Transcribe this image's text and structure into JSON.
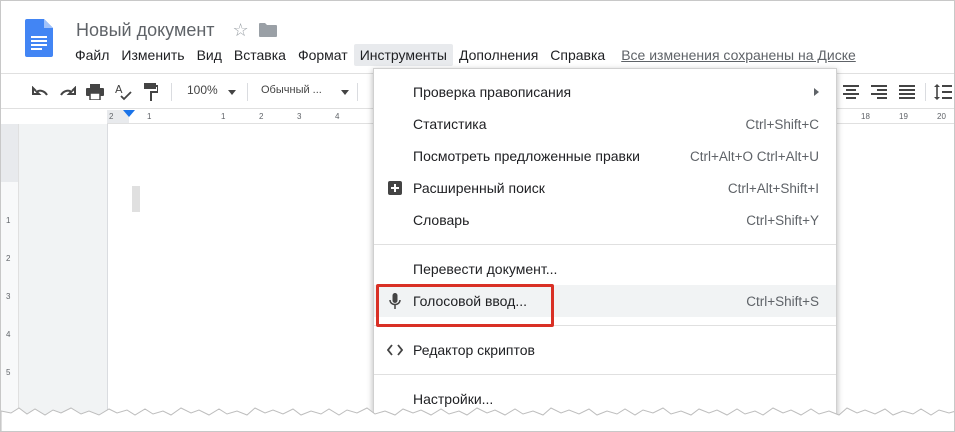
{
  "document": {
    "title": "Новый документ"
  },
  "menu": {
    "items": [
      {
        "label": "Файл"
      },
      {
        "label": "Изменить"
      },
      {
        "label": "Вид"
      },
      {
        "label": "Вставка"
      },
      {
        "label": "Формат"
      },
      {
        "label": "Инструменты"
      },
      {
        "label": "Дополнения"
      },
      {
        "label": "Справка"
      }
    ],
    "save_status": "Все изменения сохранены на Диске"
  },
  "toolbar": {
    "zoom": "100%",
    "style": "Обычный ..."
  },
  "ruler": {
    "ticks": [
      "2",
      "1",
      "1",
      "2",
      "3",
      "4",
      "18",
      "19",
      "20"
    ],
    "vertical_ticks": [
      "1",
      "2",
      "3",
      "4",
      "5"
    ]
  },
  "tools_menu": {
    "items": [
      {
        "label": "Проверка правописания",
        "shortcut": "",
        "submenu": true
      },
      {
        "label": "Статистика",
        "shortcut": "Ctrl+Shift+C"
      },
      {
        "label": "Посмотреть предложенные правки",
        "shortcut": "Ctrl+Alt+O Ctrl+Alt+U"
      },
      {
        "label": "Расширенный поиск",
        "shortcut": "Ctrl+Alt+Shift+I",
        "icon": "explore-plus-icon"
      },
      {
        "label": "Словарь",
        "shortcut": "Ctrl+Shift+Y"
      },
      {
        "label": "Перевести документ...",
        "shortcut": ""
      },
      {
        "label": "Голосовой ввод...",
        "shortcut": "Ctrl+Shift+S",
        "icon": "microphone-icon"
      },
      {
        "label": "Редактор скриптов",
        "shortcut": "",
        "icon": "code-icon"
      },
      {
        "label": "Настройки...",
        "shortcut": ""
      }
    ]
  },
  "colors": {
    "highlight": "#d93025",
    "doc_icon": "#4285f4",
    "accent": "#1a73e8"
  }
}
